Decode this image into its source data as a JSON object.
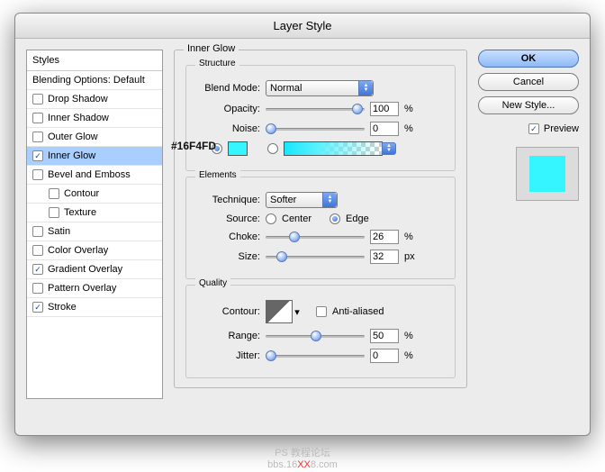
{
  "title": "Layer Style",
  "sidebar": {
    "head": "Styles",
    "blend_defaults": "Blending Options: Default",
    "items": [
      {
        "label": "Drop Shadow",
        "checked": false
      },
      {
        "label": "Inner Shadow",
        "checked": false
      },
      {
        "label": "Outer Glow",
        "checked": false
      },
      {
        "label": "Inner Glow",
        "checked": true,
        "selected": true
      },
      {
        "label": "Bevel and Emboss",
        "checked": false
      },
      {
        "label": "Contour",
        "checked": false,
        "indent": true
      },
      {
        "label": "Texture",
        "checked": false,
        "indent": true
      },
      {
        "label": "Satin",
        "checked": false
      },
      {
        "label": "Color Overlay",
        "checked": false
      },
      {
        "label": "Gradient Overlay",
        "checked": true
      },
      {
        "label": "Pattern Overlay",
        "checked": false
      },
      {
        "label": "Stroke",
        "checked": true
      }
    ]
  },
  "panel_title": "Inner Glow",
  "structure": {
    "title": "Structure",
    "blend_mode_label": "Blend Mode:",
    "blend_mode_value": "Normal",
    "opacity_label": "Opacity:",
    "opacity_value": "100",
    "opacity_unit": "%",
    "noise_label": "Noise:",
    "noise_value": "0",
    "noise_unit": "%",
    "color_hex": "#16F4FD",
    "color_swatch": "#35f5ff"
  },
  "elements": {
    "title": "Elements",
    "technique_label": "Technique:",
    "technique_value": "Softer",
    "source_label": "Source:",
    "source_center": "Center",
    "source_edge": "Edge",
    "choke_label": "Choke:",
    "choke_value": "26",
    "choke_unit": "%",
    "size_label": "Size:",
    "size_value": "32",
    "size_unit": "px"
  },
  "quality": {
    "title": "Quality",
    "contour_label": "Contour:",
    "anti_aliased_label": "Anti-aliased",
    "range_label": "Range:",
    "range_value": "50",
    "range_unit": "%",
    "jitter_label": "Jitter:",
    "jitter_value": "0",
    "jitter_unit": "%"
  },
  "buttons": {
    "ok": "OK",
    "cancel": "Cancel",
    "new_style": "New Style...",
    "preview": "Preview"
  },
  "footer": {
    "line1": "PS 教程论坛",
    "host_pre": "bbs.16",
    "host_mid": "XX",
    "host_post": "8.com"
  }
}
